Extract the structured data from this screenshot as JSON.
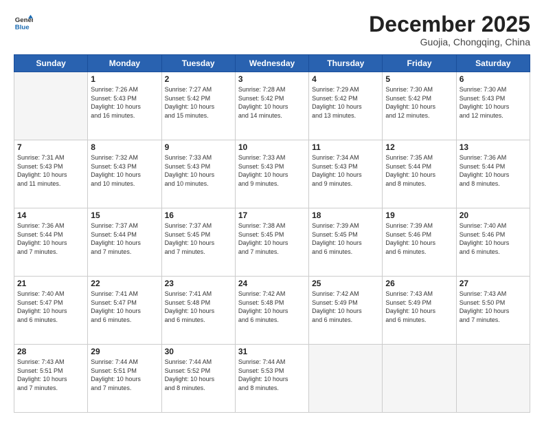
{
  "header": {
    "logo_line1": "General",
    "logo_line2": "Blue",
    "month": "December 2025",
    "location": "Guojia, Chongqing, China"
  },
  "weekdays": [
    "Sunday",
    "Monday",
    "Tuesday",
    "Wednesday",
    "Thursday",
    "Friday",
    "Saturday"
  ],
  "weeks": [
    [
      {
        "day": "",
        "info": ""
      },
      {
        "day": "1",
        "info": "Sunrise: 7:26 AM\nSunset: 5:43 PM\nDaylight: 10 hours\nand 16 minutes."
      },
      {
        "day": "2",
        "info": "Sunrise: 7:27 AM\nSunset: 5:42 PM\nDaylight: 10 hours\nand 15 minutes."
      },
      {
        "day": "3",
        "info": "Sunrise: 7:28 AM\nSunset: 5:42 PM\nDaylight: 10 hours\nand 14 minutes."
      },
      {
        "day": "4",
        "info": "Sunrise: 7:29 AM\nSunset: 5:42 PM\nDaylight: 10 hours\nand 13 minutes."
      },
      {
        "day": "5",
        "info": "Sunrise: 7:30 AM\nSunset: 5:42 PM\nDaylight: 10 hours\nand 12 minutes."
      },
      {
        "day": "6",
        "info": "Sunrise: 7:30 AM\nSunset: 5:43 PM\nDaylight: 10 hours\nand 12 minutes."
      }
    ],
    [
      {
        "day": "7",
        "info": "Sunrise: 7:31 AM\nSunset: 5:43 PM\nDaylight: 10 hours\nand 11 minutes."
      },
      {
        "day": "8",
        "info": "Sunrise: 7:32 AM\nSunset: 5:43 PM\nDaylight: 10 hours\nand 10 minutes."
      },
      {
        "day": "9",
        "info": "Sunrise: 7:33 AM\nSunset: 5:43 PM\nDaylight: 10 hours\nand 10 minutes."
      },
      {
        "day": "10",
        "info": "Sunrise: 7:33 AM\nSunset: 5:43 PM\nDaylight: 10 hours\nand 9 minutes."
      },
      {
        "day": "11",
        "info": "Sunrise: 7:34 AM\nSunset: 5:43 PM\nDaylight: 10 hours\nand 9 minutes."
      },
      {
        "day": "12",
        "info": "Sunrise: 7:35 AM\nSunset: 5:44 PM\nDaylight: 10 hours\nand 8 minutes."
      },
      {
        "day": "13",
        "info": "Sunrise: 7:36 AM\nSunset: 5:44 PM\nDaylight: 10 hours\nand 8 minutes."
      }
    ],
    [
      {
        "day": "14",
        "info": "Sunrise: 7:36 AM\nSunset: 5:44 PM\nDaylight: 10 hours\nand 7 minutes."
      },
      {
        "day": "15",
        "info": "Sunrise: 7:37 AM\nSunset: 5:44 PM\nDaylight: 10 hours\nand 7 minutes."
      },
      {
        "day": "16",
        "info": "Sunrise: 7:37 AM\nSunset: 5:45 PM\nDaylight: 10 hours\nand 7 minutes."
      },
      {
        "day": "17",
        "info": "Sunrise: 7:38 AM\nSunset: 5:45 PM\nDaylight: 10 hours\nand 7 minutes."
      },
      {
        "day": "18",
        "info": "Sunrise: 7:39 AM\nSunset: 5:45 PM\nDaylight: 10 hours\nand 6 minutes."
      },
      {
        "day": "19",
        "info": "Sunrise: 7:39 AM\nSunset: 5:46 PM\nDaylight: 10 hours\nand 6 minutes."
      },
      {
        "day": "20",
        "info": "Sunrise: 7:40 AM\nSunset: 5:46 PM\nDaylight: 10 hours\nand 6 minutes."
      }
    ],
    [
      {
        "day": "21",
        "info": "Sunrise: 7:40 AM\nSunset: 5:47 PM\nDaylight: 10 hours\nand 6 minutes."
      },
      {
        "day": "22",
        "info": "Sunrise: 7:41 AM\nSunset: 5:47 PM\nDaylight: 10 hours\nand 6 minutes."
      },
      {
        "day": "23",
        "info": "Sunrise: 7:41 AM\nSunset: 5:48 PM\nDaylight: 10 hours\nand 6 minutes."
      },
      {
        "day": "24",
        "info": "Sunrise: 7:42 AM\nSunset: 5:48 PM\nDaylight: 10 hours\nand 6 minutes."
      },
      {
        "day": "25",
        "info": "Sunrise: 7:42 AM\nSunset: 5:49 PM\nDaylight: 10 hours\nand 6 minutes."
      },
      {
        "day": "26",
        "info": "Sunrise: 7:43 AM\nSunset: 5:49 PM\nDaylight: 10 hours\nand 6 minutes."
      },
      {
        "day": "27",
        "info": "Sunrise: 7:43 AM\nSunset: 5:50 PM\nDaylight: 10 hours\nand 7 minutes."
      }
    ],
    [
      {
        "day": "28",
        "info": "Sunrise: 7:43 AM\nSunset: 5:51 PM\nDaylight: 10 hours\nand 7 minutes."
      },
      {
        "day": "29",
        "info": "Sunrise: 7:44 AM\nSunset: 5:51 PM\nDaylight: 10 hours\nand 7 minutes."
      },
      {
        "day": "30",
        "info": "Sunrise: 7:44 AM\nSunset: 5:52 PM\nDaylight: 10 hours\nand 8 minutes."
      },
      {
        "day": "31",
        "info": "Sunrise: 7:44 AM\nSunset: 5:53 PM\nDaylight: 10 hours\nand 8 minutes."
      },
      {
        "day": "",
        "info": ""
      },
      {
        "day": "",
        "info": ""
      },
      {
        "day": "",
        "info": ""
      }
    ]
  ]
}
